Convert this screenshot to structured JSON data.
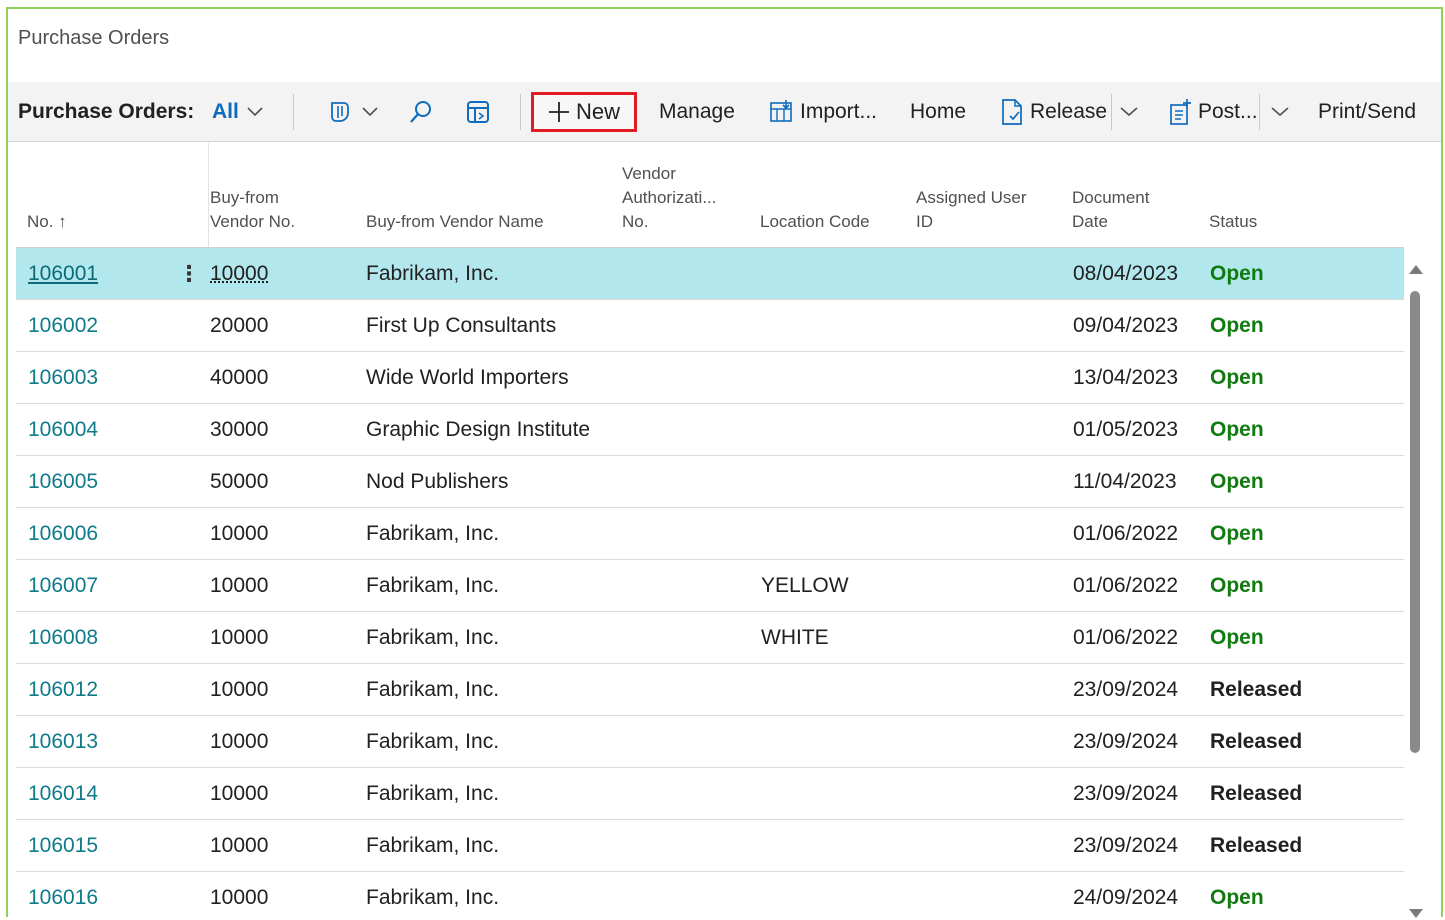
{
  "page": {
    "title": "Purchase Orders"
  },
  "actionbar": {
    "caption": "Purchase Orders:",
    "view": "All",
    "new_label": "New",
    "manage_label": "Manage",
    "import_label": "Import...",
    "home_label": "Home",
    "release_label": "Release",
    "post_label": "Post...",
    "print_label": "Print/Send"
  },
  "columns": {
    "no": "No. ↑",
    "vendor_no_1": "Buy-from",
    "vendor_no_2": "Vendor No.",
    "vendor_name": "Buy-from Vendor Name",
    "vendor_auth_1": "Vendor",
    "vendor_auth_2": "Authorizati...",
    "vendor_auth_3": "No.",
    "location": "Location Code",
    "assigned_1": "Assigned User",
    "assigned_2": "ID",
    "doc_date_1": "Document",
    "doc_date_2": "Date",
    "status": "Status"
  },
  "rows": [
    {
      "no": "106001",
      "vendor": "10000",
      "name": "Fabrikam, Inc.",
      "location": "",
      "date": "08/04/2023",
      "status": "Open"
    },
    {
      "no": "106002",
      "vendor": "20000",
      "name": "First Up Consultants",
      "location": "",
      "date": "09/04/2023",
      "status": "Open"
    },
    {
      "no": "106003",
      "vendor": "40000",
      "name": "Wide World Importers",
      "location": "",
      "date": "13/04/2023",
      "status": "Open"
    },
    {
      "no": "106004",
      "vendor": "30000",
      "name": "Graphic Design Institute",
      "location": "",
      "date": "01/05/2023",
      "status": "Open"
    },
    {
      "no": "106005",
      "vendor": "50000",
      "name": "Nod Publishers",
      "location": "",
      "date": "11/04/2023",
      "status": "Open"
    },
    {
      "no": "106006",
      "vendor": "10000",
      "name": "Fabrikam, Inc.",
      "location": "",
      "date": "01/06/2022",
      "status": "Open"
    },
    {
      "no": "106007",
      "vendor": "10000",
      "name": "Fabrikam, Inc.",
      "location": "YELLOW",
      "date": "01/06/2022",
      "status": "Open"
    },
    {
      "no": "106008",
      "vendor": "10000",
      "name": "Fabrikam, Inc.",
      "location": "WHITE",
      "date": "01/06/2022",
      "status": "Open"
    },
    {
      "no": "106012",
      "vendor": "10000",
      "name": "Fabrikam, Inc.",
      "location": "",
      "date": "23/09/2024",
      "status": "Released"
    },
    {
      "no": "106013",
      "vendor": "10000",
      "name": "Fabrikam, Inc.",
      "location": "",
      "date": "23/09/2024",
      "status": "Released"
    },
    {
      "no": "106014",
      "vendor": "10000",
      "name": "Fabrikam, Inc.",
      "location": "",
      "date": "23/09/2024",
      "status": "Released"
    },
    {
      "no": "106015",
      "vendor": "10000",
      "name": "Fabrikam, Inc.",
      "location": "",
      "date": "23/09/2024",
      "status": "Released"
    },
    {
      "no": "106016",
      "vendor": "10000",
      "name": "Fabrikam, Inc.",
      "location": "",
      "date": "24/09/2024",
      "status": "Open"
    }
  ],
  "row_menu_icon": "⋮",
  "colors": {
    "link": "#0f7b8a",
    "open": "#107c10",
    "selected_row": "#b2e7ed",
    "highlight_box": "#e11b22",
    "frame": "#8fd15a"
  }
}
